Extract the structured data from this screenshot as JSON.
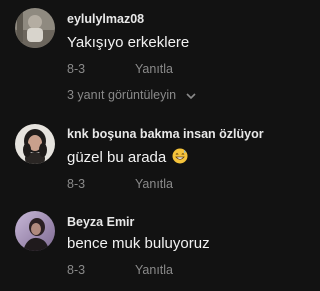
{
  "comments": [
    {
      "username": "eylulylmaz08",
      "text": "Yakışıyo erkeklere",
      "date": "8-3",
      "reply_label": "Yanıtla",
      "view_replies_label": "3 yanıt görüntüleyin"
    },
    {
      "username": "knk boşuna bakma insan özlüyor",
      "text": "güzel bu arada",
      "emoji": "grinning-sweat-emoji",
      "date": "8-3",
      "reply_label": "Yanıtla"
    },
    {
      "username": "Beyza Emir",
      "text": "bence muk buluyoruz",
      "date": "8-3",
      "reply_label": "Yanıtla"
    }
  ],
  "colors": {
    "background": "#121212",
    "username": "#e8e8e8",
    "text": "#f2f2f2",
    "meta": "#8a8a8a"
  }
}
